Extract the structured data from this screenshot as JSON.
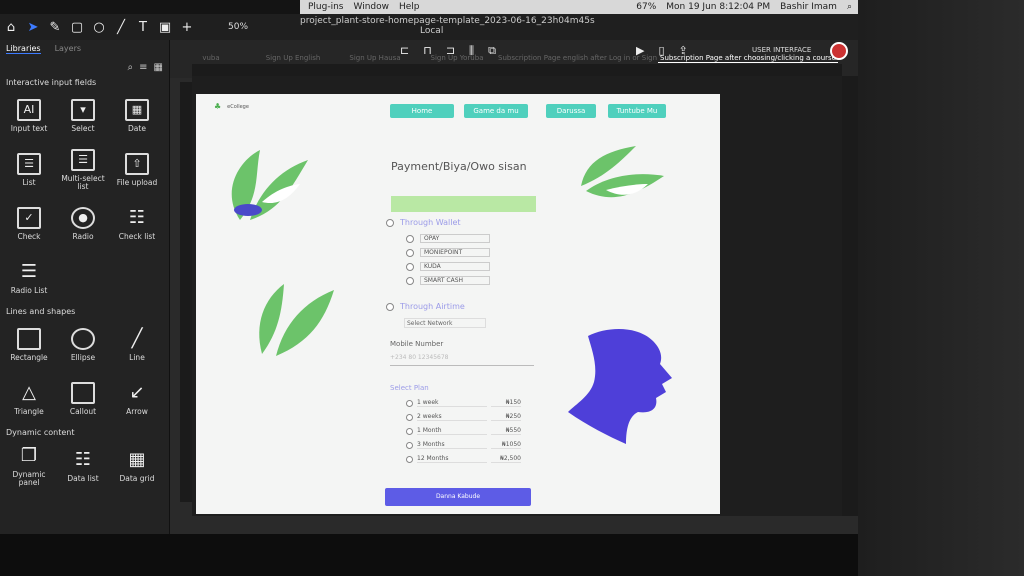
{
  "menubar": {
    "plugins": "Plug-ins",
    "window": "Window",
    "help": "Help",
    "battery": "67%",
    "clock": "Mon 19 Jun 8:12:04 PM",
    "user": "Bashir Imam"
  },
  "doc": {
    "name": "project_plant-store-homepage-template_2023-06-16_23h04m45s",
    "location": "Local"
  },
  "toolbar": {
    "zoom": "50%"
  },
  "left": {
    "tab_libraries": "Libraries",
    "tab_layers": "Layers",
    "sec_input": "Interactive input fields",
    "inputs": [
      "Input text",
      "Select",
      "Date",
      "List",
      "Multi-select list",
      "File upload",
      "Check",
      "Radio",
      "Check list",
      "Radio List"
    ],
    "sec_shapes": "Lines and shapes",
    "shapes": [
      "Rectangle",
      "Ellipse",
      "Line",
      "Triangle",
      "Callout",
      "Arrow"
    ],
    "sec_dynamic": "Dynamic content",
    "dynamic": [
      "Dynamic panel",
      "Data list",
      "Data grid"
    ]
  },
  "tabs": [
    "vuba",
    "Sign Up English",
    "Sign Up Hausa",
    "Sign Up Yoruba",
    "Subscription Page english after Log in or Sign up",
    "Subscription Page after choosing/clicking a course"
  ],
  "tabs_right": {
    "ui": "USER INTERFACE"
  },
  "page": {
    "logo": "eCollege",
    "nav": [
      "Home",
      "Game da mu",
      "Darussa",
      "Tuntube Mu"
    ],
    "title": "Payment/Biya/Owo sisan",
    "wallet": "Through Wallet",
    "wallets": [
      "OPAY",
      "MONIEPOINT",
      "KUDA",
      "SMART CASH"
    ],
    "airtime": "Through Airtime",
    "network": "Select Network",
    "mobile_label": "Mobile Number",
    "mobile_placeholder": "+234 80 12345678",
    "plan_label": "Select Plan",
    "plans": [
      {
        "name": "1 week",
        "price": "₦150"
      },
      {
        "name": "2 weeks",
        "price": "₦250"
      },
      {
        "name": "1 Month",
        "price": "₦550"
      },
      {
        "name": "3 Months",
        "price": "₦1050"
      },
      {
        "name": "12 Months",
        "price": "₦2,500"
      }
    ],
    "cta": "Danna Kabude"
  }
}
